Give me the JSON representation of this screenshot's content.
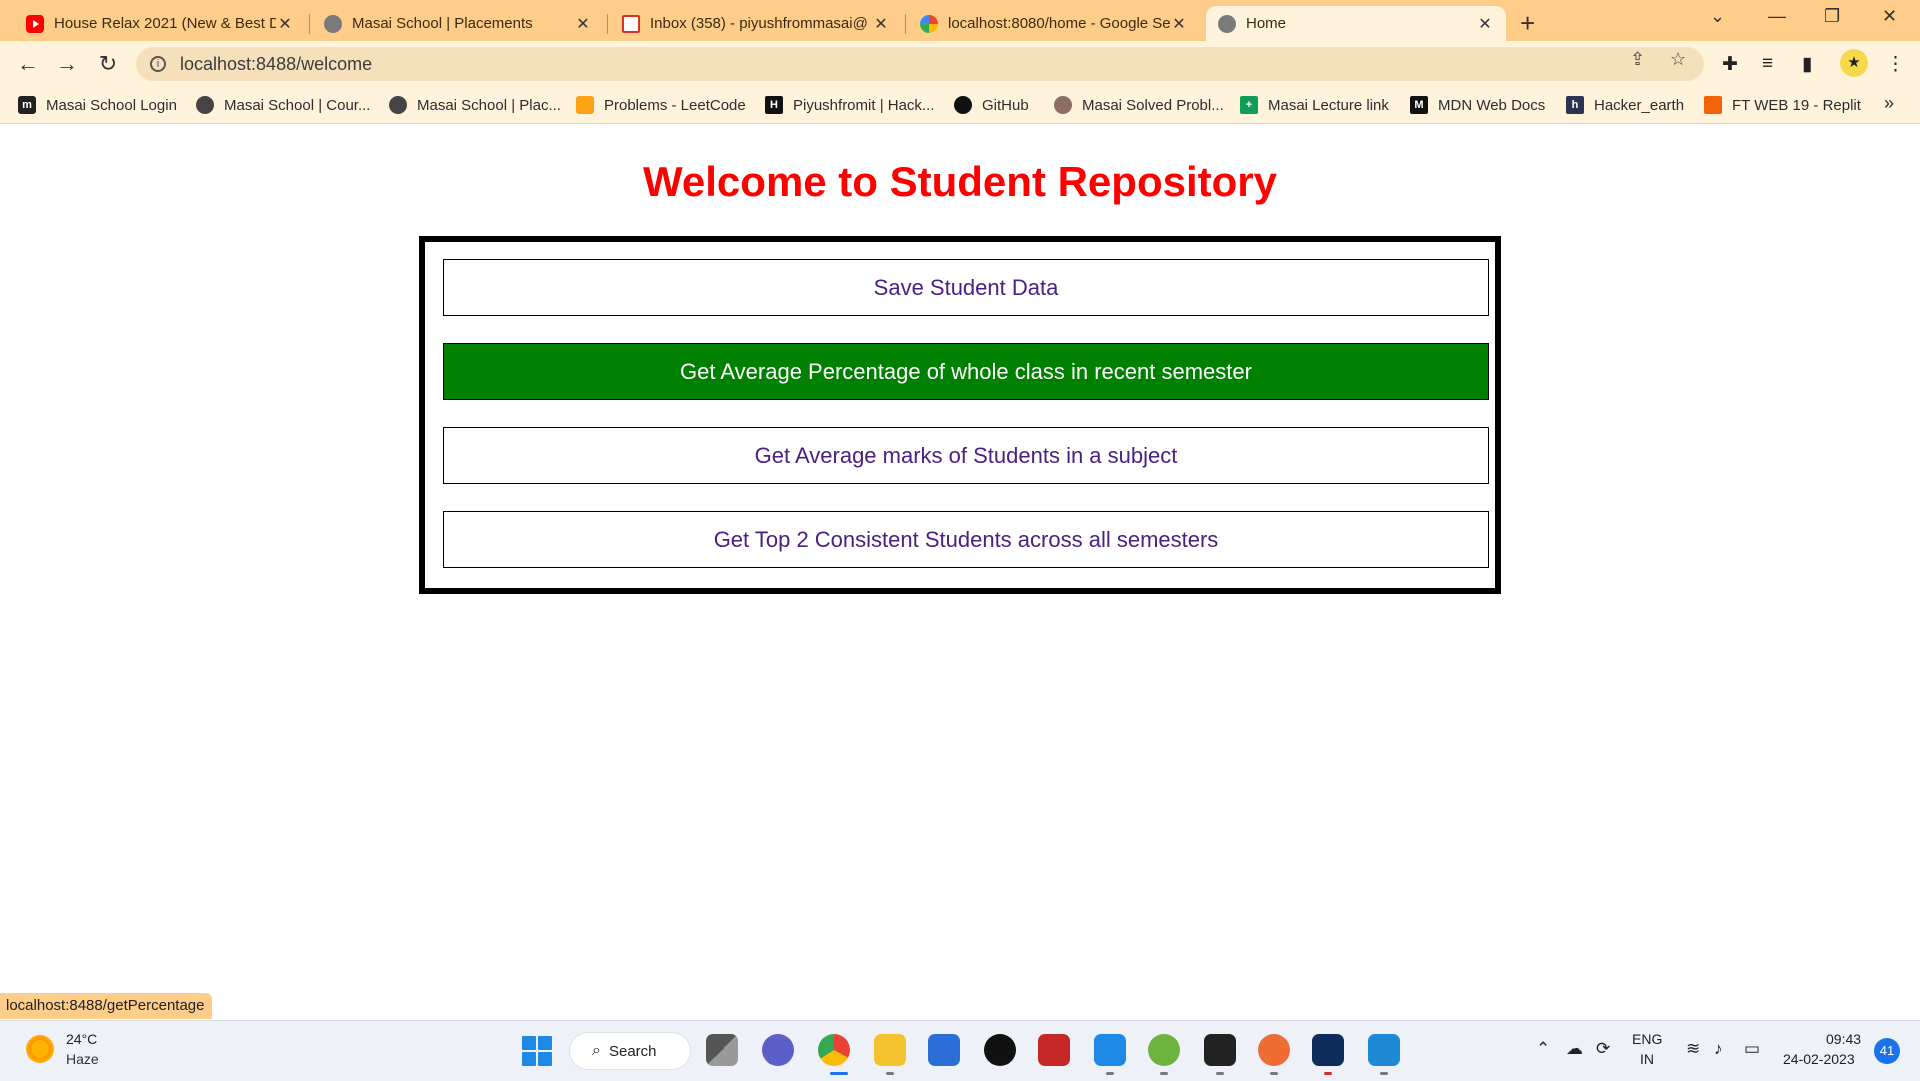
{
  "browser": {
    "tabs": [
      {
        "title": "House Relax 2021 (New & Best D",
        "icon": "youtube-icon"
      },
      {
        "title": "Masai School | Placements",
        "icon": "globe-icon"
      },
      {
        "title": "Inbox (358) - piyushfrommasai@",
        "icon": "gmail-icon"
      },
      {
        "title": "localhost:8080/home - Google Se",
        "icon": "google-icon"
      },
      {
        "title": "Home",
        "icon": "globe-icon",
        "active": true
      }
    ],
    "new_tab": "+",
    "url": "localhost:8488/welcome",
    "bookmarks": [
      {
        "label": "Masai School Login"
      },
      {
        "label": "Masai School | Cour..."
      },
      {
        "label": "Masai School | Plac..."
      },
      {
        "label": "Problems - LeetCode"
      },
      {
        "label": "Piyushfromit | Hack..."
      },
      {
        "label": "GitHub"
      },
      {
        "label": "Masai Solved Probl..."
      },
      {
        "label": "Masai Lecture link"
      },
      {
        "label": "MDN Web Docs"
      },
      {
        "label": "Hacker_earth"
      },
      {
        "label": "FT WEB 19 - Replit"
      }
    ],
    "bookmarks_overflow": "»",
    "status_url": "localhost:8488/getPercentage"
  },
  "page": {
    "title": "Welcome to Student Repository",
    "buttons": [
      {
        "label": "Save Student Data"
      },
      {
        "label": "Get Average Percentage of whole class in recent semester"
      },
      {
        "label": "Get Average marks of Students in a subject"
      },
      {
        "label": "Get Top 2 Consistent Students across all semesters"
      }
    ],
    "colors": {
      "title": "#ff0000",
      "hover_button": "#008000",
      "button_text": "#4b2083"
    }
  },
  "taskbar": {
    "weather": {
      "temp": "24°C",
      "desc": "Haze"
    },
    "search_label": "Search",
    "language": {
      "line1": "ENG",
      "line2": "IN"
    },
    "clock": {
      "time": "09:43",
      "date": "24-02-2023"
    },
    "notifications": "41"
  }
}
